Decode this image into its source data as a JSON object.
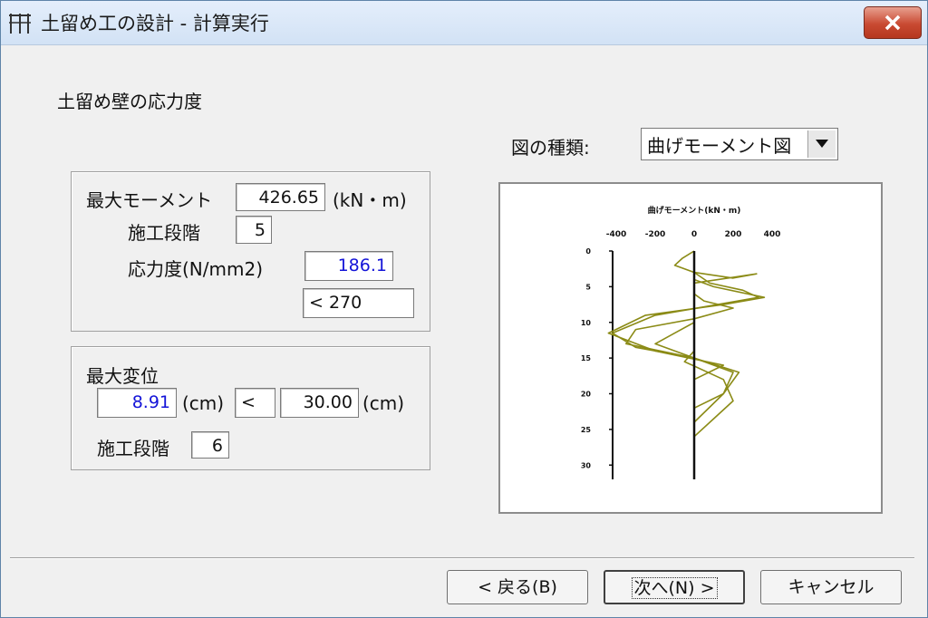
{
  "window": {
    "title": "土留め工の設計 - 計算実行",
    "app_icon": "wall-icon"
  },
  "section_title": "土留め壁の応力度",
  "figure_type": {
    "label": "図の種類:",
    "selected": "曲げモーメント図"
  },
  "moment_group": {
    "max_moment_label": "最大モーメント",
    "max_moment_value": "426.65",
    "max_moment_unit": "(kN・m)",
    "stage_label": "施工段階",
    "stage_value": "5",
    "stress_label": "応力度(N/mm2)",
    "stress_value": "186.1",
    "stress_limit": "< 270"
  },
  "disp_group": {
    "max_disp_label": "最大変位",
    "max_disp_value": "8.91",
    "unit1": "(cm)",
    "compare": "<",
    "limit_value": "30.00",
    "unit2": "(cm)",
    "stage_label": "施工段階",
    "stage_value": "6"
  },
  "chart_data": {
    "type": "line",
    "title": "曲げモーメント(kN・m)",
    "x_ticks": [
      "-400",
      "-200",
      "0",
      "200",
      "400"
    ],
    "xlim": [
      -480,
      400
    ],
    "y_ticks": [
      "0",
      "5",
      "10",
      "15",
      "20",
      "25",
      "30"
    ],
    "ylim": [
      0,
      32
    ],
    "line_color": "#8b8b16",
    "series": [
      {
        "x": [
          0,
          -60,
          -100,
          0,
          200,
          320,
          0,
          0
        ],
        "y": [
          0,
          1,
          2,
          3,
          3.8,
          3.2,
          4.5,
          32
        ]
      },
      {
        "x": [
          0,
          80,
          250,
          330,
          120,
          -200,
          -420,
          -300,
          0,
          0
        ],
        "y": [
          3,
          4.5,
          5.5,
          6.5,
          7.5,
          9,
          11.5,
          13.5,
          15,
          32
        ]
      },
      {
        "x": [
          0,
          100,
          360,
          150,
          -250,
          -440,
          -200,
          150,
          0,
          0
        ],
        "y": [
          4,
          5,
          6.5,
          7.5,
          9,
          11.5,
          14,
          16,
          18,
          32
        ]
      },
      {
        "x": [
          0,
          50,
          200,
          0,
          -300,
          -350,
          0,
          200,
          150,
          0,
          0
        ],
        "y": [
          6,
          7,
          8,
          9.5,
          11,
          13,
          15,
          17,
          20,
          22,
          32
        ]
      },
      {
        "x": [
          0,
          -100,
          -200,
          0,
          230,
          150,
          0,
          0
        ],
        "y": [
          10,
          11.5,
          13,
          15,
          17,
          20,
          24,
          32
        ]
      },
      {
        "x": [
          0,
          -50,
          150,
          200,
          100,
          0,
          0
        ],
        "y": [
          14,
          15.5,
          18,
          21,
          23.5,
          26,
          32
        ]
      }
    ]
  },
  "buttons": {
    "back": "< 戻る(B)",
    "next": "次へ(N) >",
    "cancel": "キャンセル"
  }
}
